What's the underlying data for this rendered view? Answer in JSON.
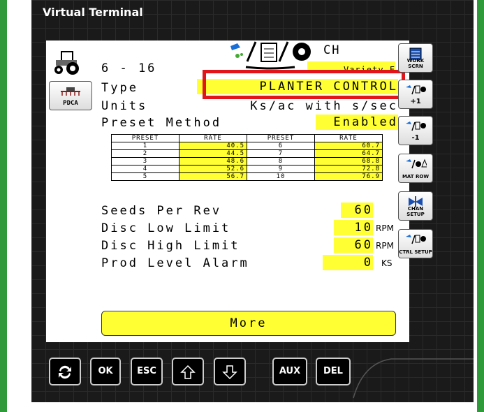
{
  "window": {
    "title": "Virtual Terminal"
  },
  "header": {
    "page_number": "6 - 16",
    "ch_label": "CH",
    "variety": "Variety F"
  },
  "fields": {
    "type_label": "Type",
    "type_value": "PLANTER CONTROL",
    "units_label": "Units",
    "units_value": "Ks/ac with s/sec",
    "preset_method_label": "Preset Method",
    "preset_method_value": "Enabled",
    "seeds_per_rev_label": "Seeds Per Rev",
    "seeds_per_rev_value": "60",
    "disc_low_label": "Disc Low Limit",
    "disc_low_value": "10",
    "disc_low_unit": "RPM",
    "disc_high_label": "Disc High Limit",
    "disc_high_value": "60",
    "disc_high_unit": "RPM",
    "prod_level_label": "Prod Level Alarm",
    "prod_level_value": "0",
    "prod_level_unit": "KS"
  },
  "preset_table": {
    "headers": [
      "PRESET",
      "RATE",
      "PRESET",
      "RATE"
    ],
    "rows": [
      [
        "1",
        "40.5",
        "6",
        "60.7"
      ],
      [
        "2",
        "44.5",
        "7",
        "64.7"
      ],
      [
        "3",
        "48.6",
        "8",
        "68.8"
      ],
      [
        "4",
        "52.6",
        "9",
        "72.8"
      ],
      [
        "5",
        "56.7",
        "10",
        "76.9"
      ]
    ]
  },
  "more_button": "More",
  "left_buttons": {
    "pdca": "PDCA"
  },
  "right_buttons": {
    "work_scrn": "WORK SCRN",
    "plus1": "+1",
    "minus1": "-1",
    "mat_row": "MAT ROW",
    "chan_setup": "CHAN SETUP",
    "ctrl_setup": "CTRL SETUP"
  },
  "bottom_buttons": {
    "ok": "OK",
    "esc": "ESC",
    "aux": "AUX",
    "del": "DEL"
  },
  "colors": {
    "highlight": "#ffff33",
    "annotation_box": "#e0141a",
    "frame": "#2e9a3a"
  }
}
